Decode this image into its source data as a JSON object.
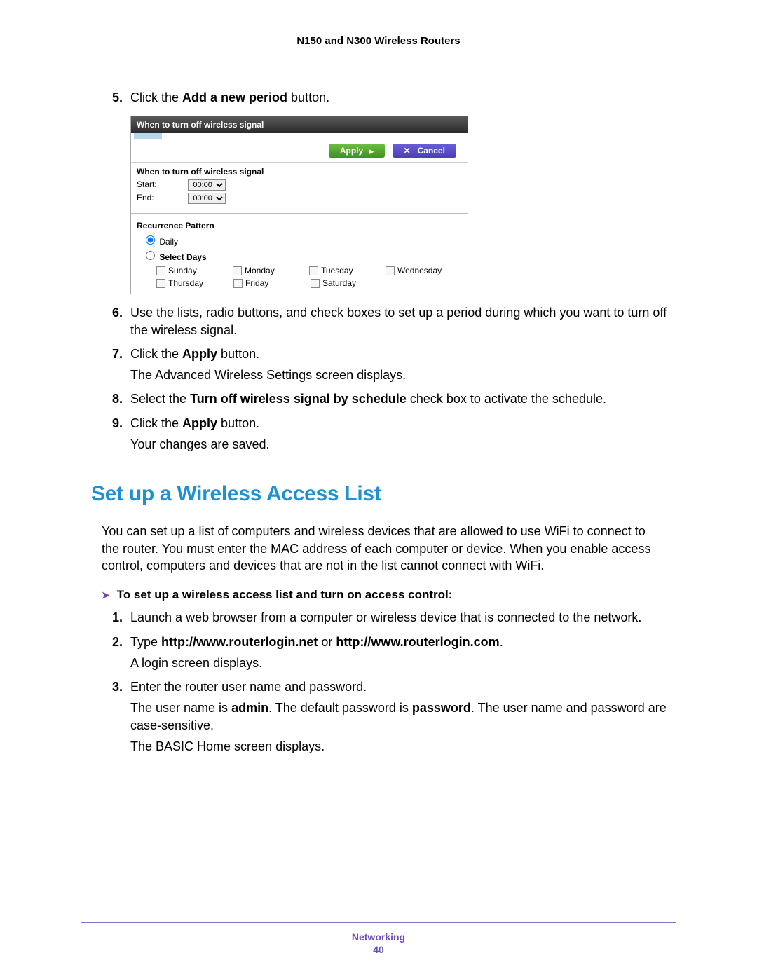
{
  "header": {
    "title": "N150 and N300 Wireless Routers"
  },
  "steps_a": [
    {
      "num": "5.",
      "pre": "Click the ",
      "bold": "Add a new period",
      "post": " button."
    }
  ],
  "shot": {
    "title": "When to turn off wireless signal",
    "apply": "Apply",
    "cancel": "Cancel",
    "sec1_title": "When to turn off wireless signal",
    "start_label": "Start:",
    "end_label": "End:",
    "time_value": "00:00",
    "sec2_title": "Recurrence Pattern",
    "radio_daily": "Daily",
    "radio_select": "Select Days",
    "days_row1": [
      "Sunday",
      "Monday",
      "Tuesday",
      "Wednesday"
    ],
    "days_row2": [
      "Thursday",
      "Friday",
      "Saturday"
    ]
  },
  "steps_b": [
    {
      "num": "6.",
      "text": "Use the lists, radio buttons, and check boxes to set up a period during which you want to turn off the wireless signal."
    },
    {
      "num": "7.",
      "pre": "Click the ",
      "bold": "Apply",
      "post": " button.",
      "sub": "The Advanced Wireless Settings screen displays."
    },
    {
      "num": "8.",
      "pre": "Select the ",
      "bold": "Turn off wireless signal by schedule",
      "post": " check box to activate the schedule."
    },
    {
      "num": "9.",
      "pre": "Click the ",
      "bold": "Apply",
      "post": " button.",
      "sub": "Your changes are saved."
    }
  ],
  "section_title": "Set up a Wireless Access List",
  "section_para": "You can set up a list of computers and wireless devices that are allowed to use WiFi to connect to the router. You must enter the MAC address of each computer or device. When you enable access control, computers and devices that are not in the list cannot connect with WiFi.",
  "proc_title": "To set up a wireless access list and turn on access control:",
  "steps_c": [
    {
      "num": "1.",
      "text": "Launch a web browser from a computer or wireless device that is connected to the network."
    },
    {
      "num": "2.",
      "pre": "Type ",
      "bold": "http://www.routerlogin.net",
      "mid": " or ",
      "bold2": "http://www.routerlogin.com",
      "post": ".",
      "sub": "A login screen displays."
    },
    {
      "num": "3.",
      "text": "Enter the router user name and password.",
      "sub_rich_1_pre": "The user name is ",
      "sub_rich_1_b1": "admin",
      "sub_rich_1_mid": ". The default password is ",
      "sub_rich_1_b2": "password",
      "sub_rich_1_post": ". The user name and password are case-sensitive.",
      "sub2": "The BASIC Home screen displays."
    }
  ],
  "footer": {
    "label": "Networking",
    "page": "40"
  }
}
